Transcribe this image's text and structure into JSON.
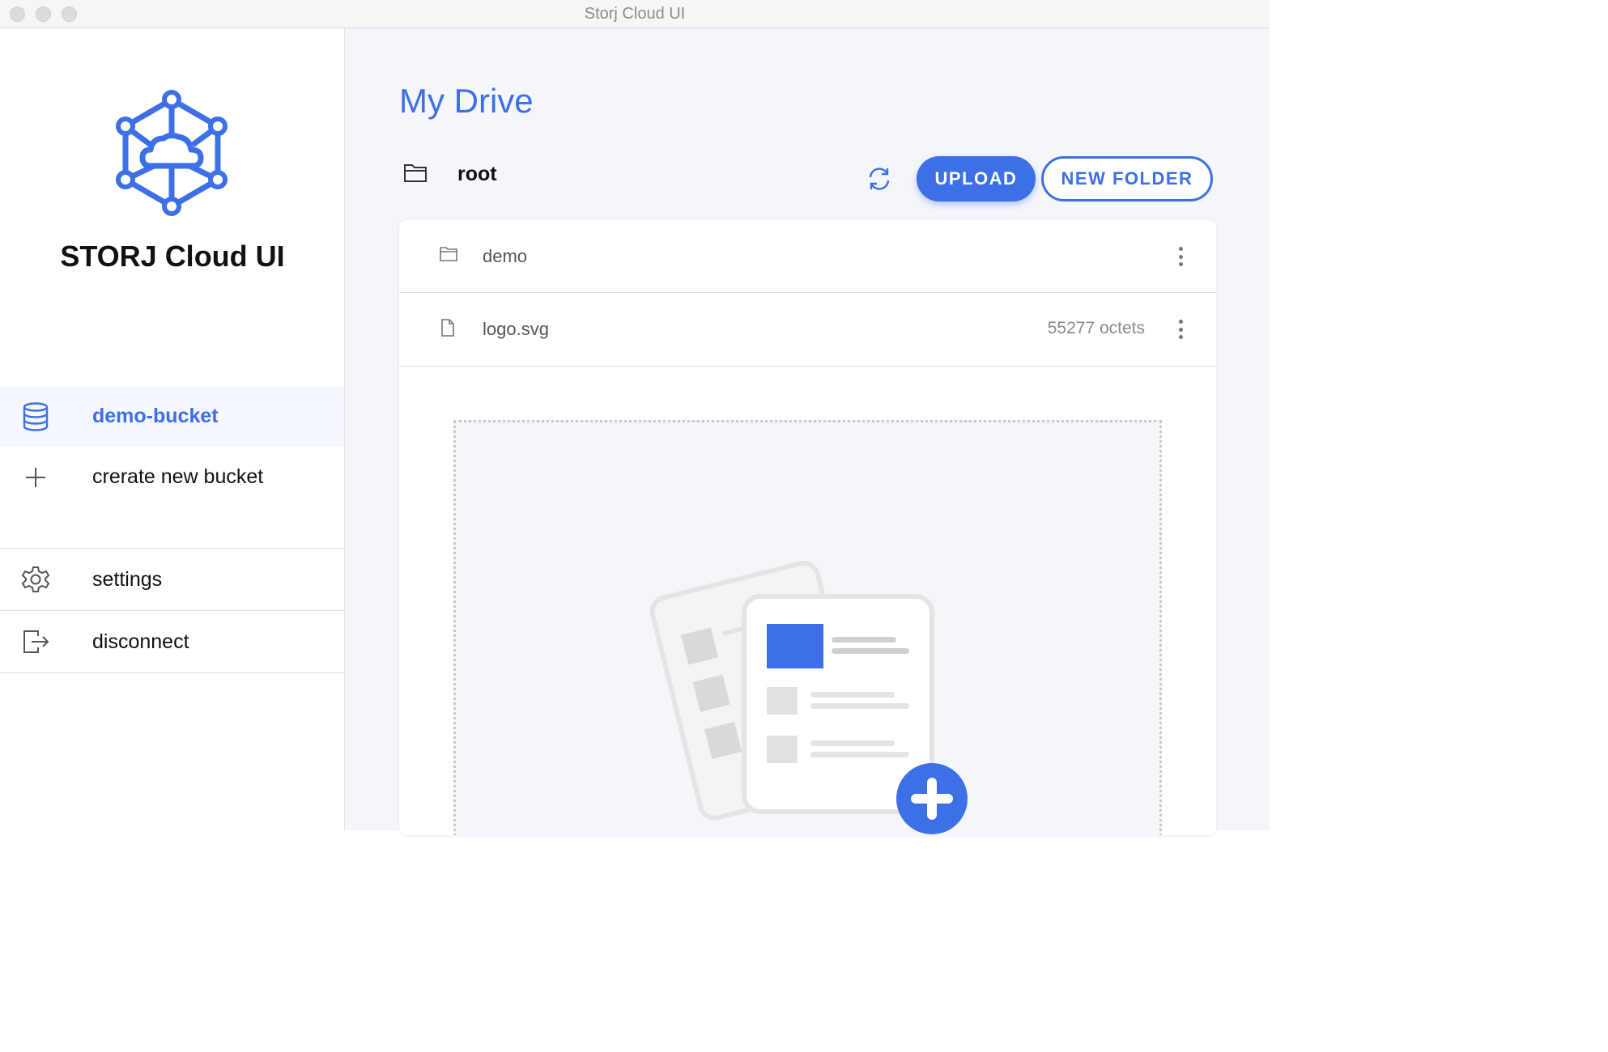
{
  "window": {
    "title": "Storj Cloud UI"
  },
  "sidebar": {
    "app_name": "STORJ Cloud UI",
    "items": [
      {
        "label": "demo-bucket",
        "icon": "database-icon",
        "active": true
      },
      {
        "label": "crerate new bucket",
        "icon": "plus-icon"
      },
      {
        "label": "settings",
        "icon": "gear-icon"
      },
      {
        "label": "disconnect",
        "icon": "logout-icon"
      }
    ]
  },
  "main": {
    "title": "My Drive",
    "breadcrumb": "root",
    "upload_label": "UPLOAD",
    "new_folder_label": "NEW FOLDER",
    "files": [
      {
        "name": "demo",
        "type": "folder",
        "size": ""
      },
      {
        "name": "logo.svg",
        "type": "file",
        "size": "55277 octets"
      }
    ]
  },
  "colors": {
    "accent": "#3d6fe6",
    "background": "#f4f6fb"
  }
}
